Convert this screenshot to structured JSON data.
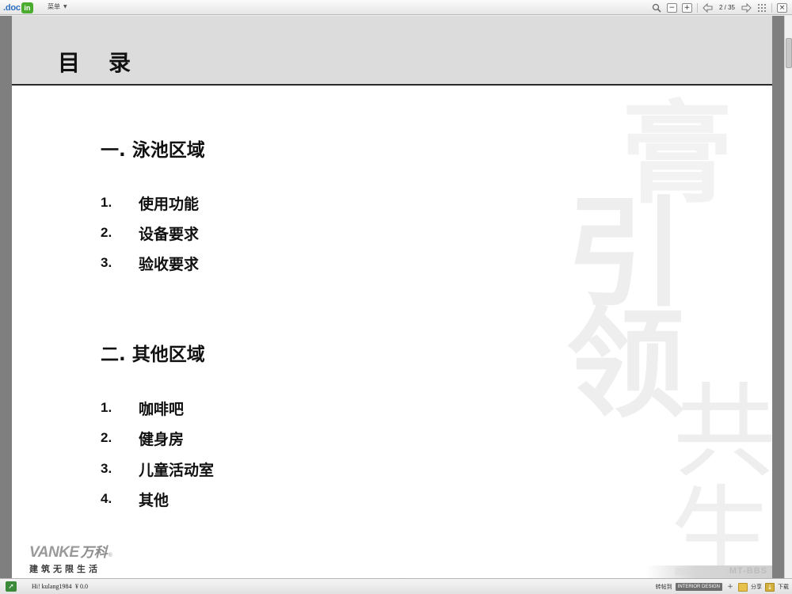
{
  "toolbar": {
    "logo_text": ".doc",
    "logo_badge": "in",
    "menu_label": "菜单",
    "page_current": "2",
    "page_total": "35"
  },
  "slide": {
    "title": "目录",
    "sections": [
      {
        "title": "一. 泳池区域",
        "items": [
          {
            "num": "1.",
            "text": "使用功能"
          },
          {
            "num": "2.",
            "text": "设备要求"
          },
          {
            "num": "3.",
            "text": "验收要求"
          }
        ]
      },
      {
        "title": "二. 其他区域",
        "items": [
          {
            "num": "1.",
            "text": "咖啡吧"
          },
          {
            "num": "2.",
            "text": "健身房"
          },
          {
            "num": "3.",
            "text": "儿童活动室"
          },
          {
            "num": "4.",
            "text": "其他"
          }
        ]
      }
    ],
    "brand": {
      "en": "VANKE",
      "cn": "万科",
      "reg": "®",
      "slogan": "建筑无限生活"
    },
    "footer_mark": "MT-BBS",
    "watermark": [
      "膏",
      "引",
      "领",
      "共",
      "生"
    ]
  },
  "statusbar": {
    "greeting": "Hi! kulang1984",
    "balance": "¥ 0.0",
    "label_left": "转帖到",
    "badge": "INTERIOR DESIGN",
    "label_share": "分享",
    "label_download": "下载"
  },
  "colors": {
    "header_bg": "#dcdcdc",
    "logo_blue": "#2f6fbf",
    "logo_green": "#4aab2f"
  }
}
